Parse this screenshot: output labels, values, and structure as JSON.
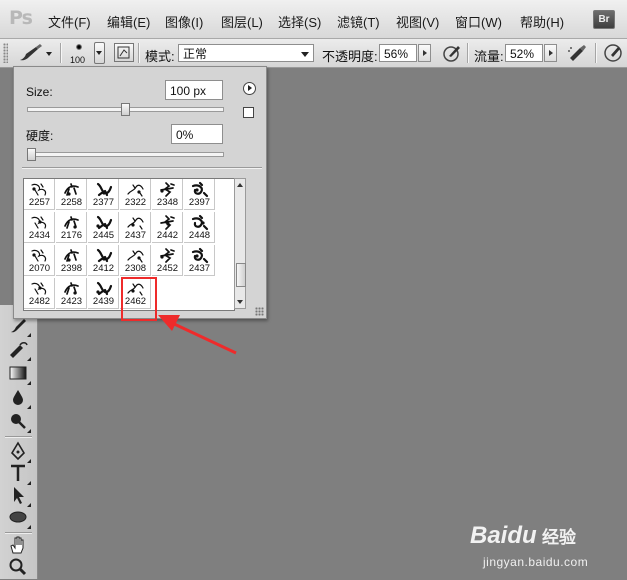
{
  "app": {
    "logo": "Ps",
    "bridge_badge": "Br"
  },
  "menu": [
    {
      "label": "文件(F)"
    },
    {
      "label": "编辑(E)"
    },
    {
      "label": "图像(I)"
    },
    {
      "label": "图层(L)"
    },
    {
      "label": "选择(S)"
    },
    {
      "label": "滤镜(T)"
    },
    {
      "label": "视图(V)"
    },
    {
      "label": "窗口(W)"
    },
    {
      "label": "帮助(H)"
    }
  ],
  "options": {
    "brush_size_preview": "100",
    "mode_label": "模式:",
    "mode_value": "正常",
    "opacity_label": "不透明度:",
    "opacity_value": "56%",
    "flow_label": "流量:",
    "flow_value": "52%"
  },
  "brush_panel": {
    "size_label": "Size:",
    "size_value": "100 px",
    "size_slider": 0.5,
    "hardness_label": "硬度:",
    "hardness_value": "0%",
    "hardness_slider": 0.0,
    "presets": [
      {
        "num": "2257"
      },
      {
        "num": "2258"
      },
      {
        "num": "2377"
      },
      {
        "num": "2322"
      },
      {
        "num": "2348"
      },
      {
        "num": "2397"
      },
      {
        "num": "2434"
      },
      {
        "num": "2176"
      },
      {
        "num": "2445"
      },
      {
        "num": "2437"
      },
      {
        "num": "2442"
      },
      {
        "num": "2448"
      },
      {
        "num": "2070"
      },
      {
        "num": "2398"
      },
      {
        "num": "2412"
      },
      {
        "num": "2308"
      },
      {
        "num": "2452"
      },
      {
        "num": "2437"
      },
      {
        "num": "2482"
      },
      {
        "num": "2423"
      },
      {
        "num": "2439"
      },
      {
        "num": "2462"
      }
    ],
    "selected_preset": "2462",
    "scroll_position": 0.75
  },
  "tools": [
    {
      "icon": "brush-tool-icon"
    },
    {
      "icon": "history-brush-icon"
    },
    {
      "icon": "gradient-tool-icon"
    },
    {
      "icon": "blur-tool-icon"
    },
    {
      "icon": "dodge-tool-icon"
    },
    {
      "icon": "pen-tool-icon"
    },
    {
      "icon": "type-tool-icon"
    },
    {
      "icon": "path-selection-icon"
    },
    {
      "icon": "ellipse-tool-icon"
    },
    {
      "icon": "hand-tool-icon"
    },
    {
      "icon": "zoom-tool-icon"
    }
  ],
  "watermark": {
    "logo": "Baidu",
    "cn": "经验",
    "url": "jingyan.baidu.com"
  },
  "colors": {
    "canvas": "#7f7f7f",
    "highlight": "#ee2b2b",
    "panel": "#d4d4d4"
  }
}
